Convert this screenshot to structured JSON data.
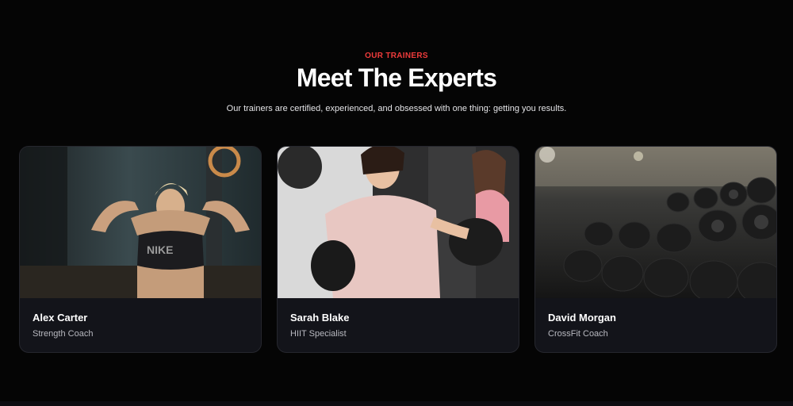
{
  "section": {
    "eyebrow": "OUR TRAINERS",
    "title": "Meet The Experts",
    "subtitle": "Our trainers are certified, experienced, and obsessed with one thing: getting you results."
  },
  "trainers": [
    {
      "name": "Alex Carter",
      "role": "Strength Coach",
      "photo_subject": "trainer-stretching-photo"
    },
    {
      "name": "Sarah Blake",
      "role": "HIIT Specialist",
      "photo_subject": "boxing-class-photo"
    },
    {
      "name": "David Morgan",
      "role": "CrossFit Coach",
      "photo_subject": "dumbbell-rack-photo"
    }
  ],
  "colors": {
    "accent": "#ef3b3b",
    "background": "#050505",
    "card": "#13141a"
  }
}
